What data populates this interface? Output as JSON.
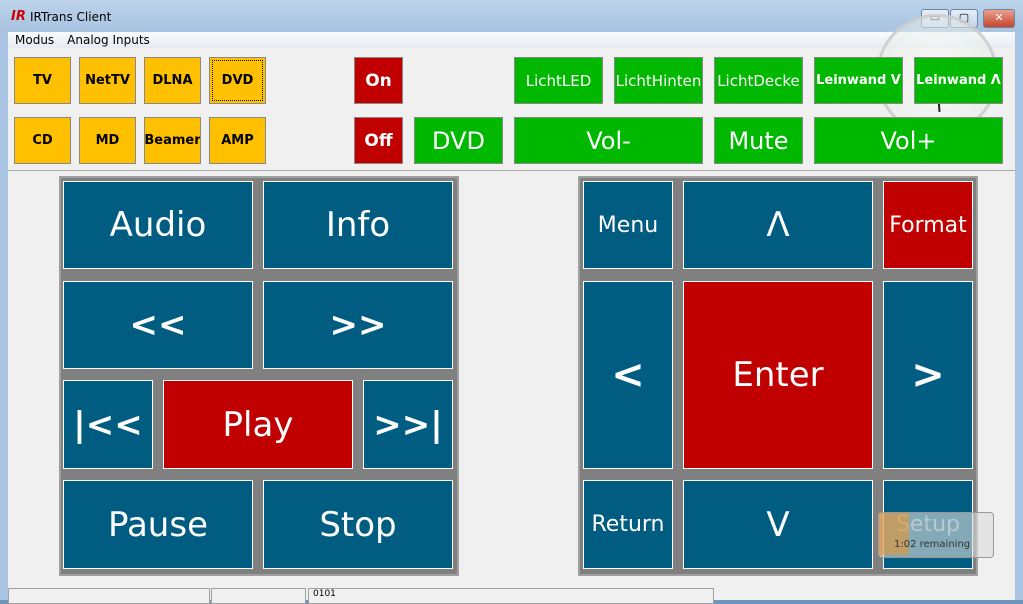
{
  "window": {
    "title": "IRTrans Client",
    "logo": "IR",
    "minimize": "▭",
    "maximize": "▢",
    "close": "✕"
  },
  "menu": [
    "Modus",
    "Analog Inputs"
  ],
  "sources": [
    "TV",
    "NetTV",
    "DLNA",
    "DVD",
    "CD",
    "MD",
    "Beamer",
    "AMP"
  ],
  "power": {
    "on": "On",
    "off": "Off"
  },
  "dvd_label": "DVD",
  "lights": [
    "LichtLED",
    "LichtHinten",
    "LichtDecke",
    "Leinwand V",
    "Leinwand Λ"
  ],
  "volume": {
    "down": "Vol-",
    "mute": "Mute",
    "up": "Vol+"
  },
  "transport": {
    "audio": "Audio",
    "info": "Info",
    "rew": "<<",
    "ffw": ">>",
    "prev": "|<<",
    "play": "Play",
    "next": ">>|",
    "pause": "Pause",
    "stop": "Stop"
  },
  "nav": {
    "menu": "Menu",
    "up": "Λ",
    "format": "Format",
    "left": "<",
    "enter": "Enter",
    "right": ">",
    "return": "Return",
    "down": "V",
    "setup": "Setup"
  },
  "battery": {
    "remaining": "1:02 remaining"
  },
  "status": {
    "text": "0101"
  },
  "colors": {
    "source": "#ffc000",
    "power": "#c00000",
    "green": "#00b800",
    "nav": "#005c80",
    "accent": "#c00000"
  }
}
